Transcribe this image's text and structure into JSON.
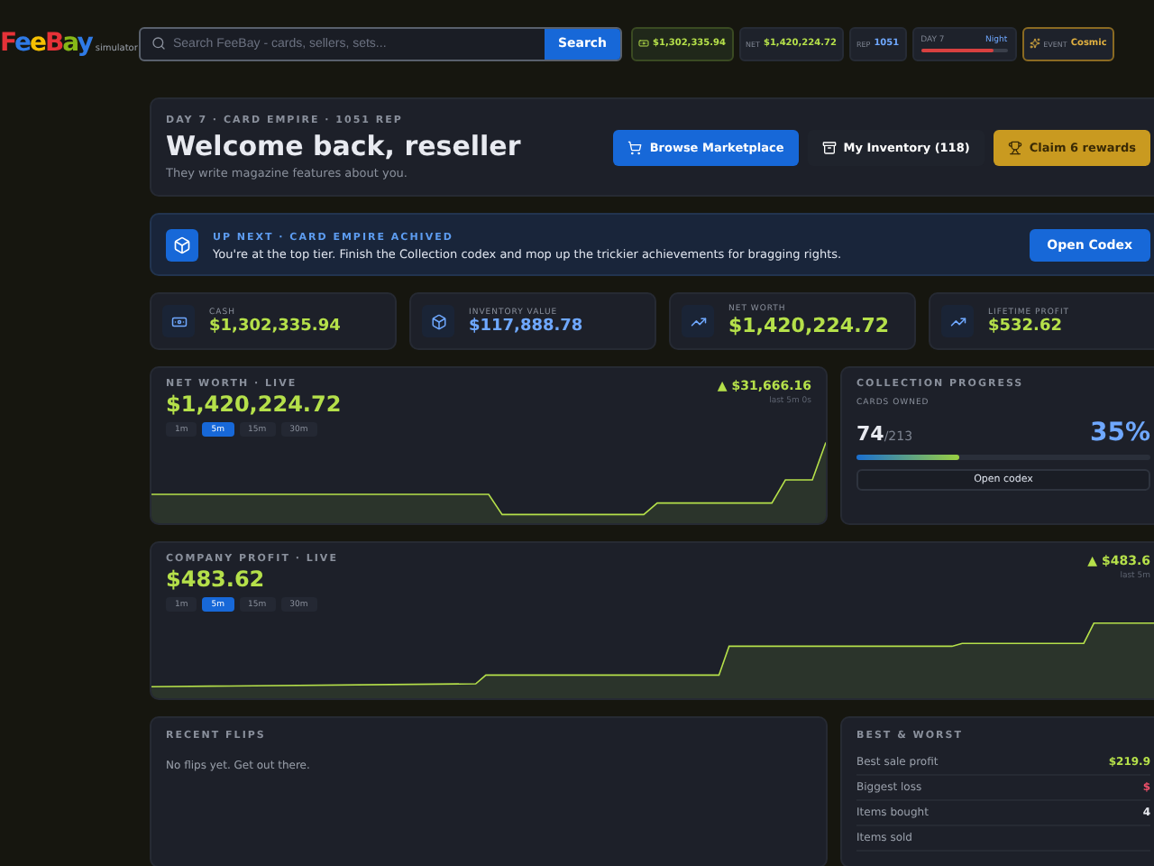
{
  "app": {
    "logo": "FeeBay",
    "tagline": "simulator"
  },
  "search": {
    "placeholder": "Search FeeBay - cards, sellers, sets...",
    "button": "Search"
  },
  "header_chips": [
    {
      "kind": "cash",
      "value": "$1,302,335.94"
    },
    {
      "kind": "stat",
      "label": "NET",
      "value": "$1,420,224.72"
    },
    {
      "kind": "stat",
      "label": "REP",
      "value": "1051"
    },
    {
      "kind": "day",
      "label": "DAY 7",
      "value": "Night",
      "level": 0.85
    },
    {
      "kind": "event",
      "label": "EVENT",
      "value": "Cosmic"
    }
  ],
  "hero": {
    "eyebrow": "DAY 7 · CARD EMPIRE · 1051 REP",
    "title": "Welcome back, reseller",
    "subtitle": "They write magazine features about you.",
    "buttons": [
      {
        "kind": "primary",
        "label": "Browse Marketplace"
      },
      {
        "kind": "secondary",
        "label": "My Inventory (118)"
      },
      {
        "kind": "gold",
        "label": "Claim 6 rewards"
      }
    ]
  },
  "banner": {
    "eyebrow": "UP NEXT · CARD EMPIRE ACHIVED",
    "text": "You're at the top tier. Finish the Collection codex and mop up the trickier achievements for bragging rights.",
    "button": "Open Codex"
  },
  "stats": [
    {
      "label": "CASH",
      "value": "$1,302,335.94",
      "color": "#b5e04a"
    },
    {
      "label": "INVENTORY VALUE",
      "value": "$117,888.78",
      "color": "#6fa8ff"
    },
    {
      "label": "NET WORTH",
      "value": "$1,420,224.72",
      "color": "#b5e04a"
    },
    {
      "label": "LIFETIME PROFIT",
      "value": "$532.62",
      "color": "#b5e04a"
    }
  ],
  "net_worth": {
    "title": "NET WORTH · LIVE",
    "value": "$1,420,224.72",
    "change": "▲ $31,666.16",
    "period": "last 5m 0s",
    "ranges": [
      {
        "label": "1m",
        "selected": false
      },
      {
        "label": "5m",
        "selected": true
      },
      {
        "label": "15m",
        "selected": false
      },
      {
        "label": "30m",
        "selected": false
      }
    ]
  },
  "collection": {
    "title": "COLLECTION PROGRESS",
    "label": "CARDS OWNED",
    "owned": "74",
    "total": "/213",
    "percent": "35%",
    "level": 0.35,
    "button": "Open codex"
  },
  "company_profit": {
    "title": "COMPANY PROFIT · LIVE",
    "value": "$483.62",
    "change": "▲ $483.6",
    "period": "last 5m",
    "ranges": [
      {
        "label": "1m",
        "selected": false
      },
      {
        "label": "5m",
        "selected": true
      },
      {
        "label": "15m",
        "selected": false
      },
      {
        "label": "30m",
        "selected": false
      }
    ]
  },
  "recent_flips": {
    "title": "RECENT FLIPS",
    "empty": "No flips yet. Get out there."
  },
  "best_worst": {
    "title": "BEST & WORST",
    "rows": [
      {
        "label": "Best sale profit",
        "value": "$219.9",
        "color": "#b5e04a"
      },
      {
        "label": "Biggest loss",
        "value": "$",
        "color": "#f0506a"
      },
      {
        "label": "Items bought",
        "value": "4",
        "color": "#e8eaf0"
      },
      {
        "label": "Items sold"
      }
    ]
  }
}
